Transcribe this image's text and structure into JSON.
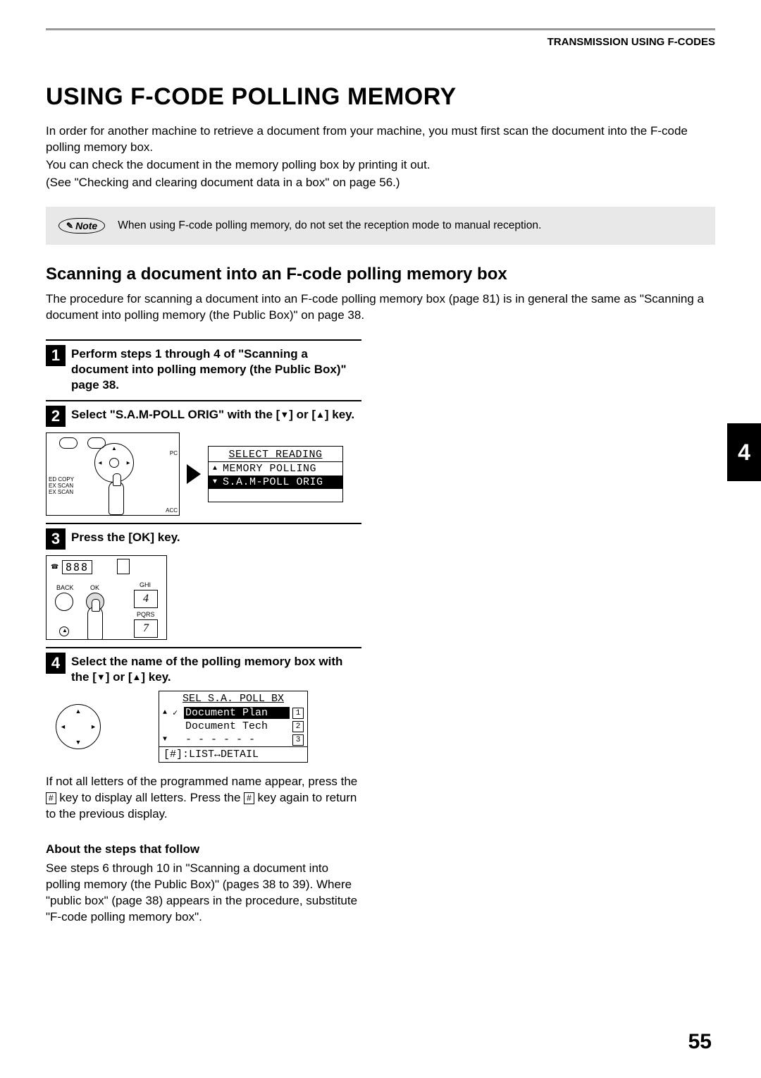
{
  "header": "TRANSMISSION USING F-CODES",
  "h1": "USING F-CODE POLLING MEMORY",
  "intro": [
    "In order for another machine to retrieve a document from your machine, you must first scan the document into the F-code polling memory box.",
    "You can check the document in the memory polling box by printing it out.",
    "(See \"Checking and clearing document data in a box\" on page 56.)"
  ],
  "note_label": "Note",
  "note_text": "When using F-code polling memory, do not set the reception mode to manual reception.",
  "h2": "Scanning a document into an F-code polling memory box",
  "sub_intro": "The procedure for scanning a document into an F-code polling memory box (page 81) is in general the same as \"Scanning a document into polling memory (the Public Box)\" on page 38.",
  "steps": {
    "s1": {
      "num": "1",
      "text": "Perform steps 1 through 4 of \"Scanning a document into polling memory (the Public Box)\" page 38."
    },
    "s2": {
      "num": "2",
      "text_pre": "Select \"S.A.M-POLL ORIG\" with the [",
      "text_post": "] key.",
      "or": "] or ["
    },
    "s3": {
      "num": "3",
      "text": "Press the [OK] key."
    },
    "s4": {
      "num": "4",
      "text_pre": "Select the name of the polling memory box with the [",
      "text_post": "] key.",
      "or": "] or ["
    }
  },
  "panel_labels": {
    "l1": "ED COPY",
    "l2": "EX SCAN",
    "l3": "EX SCAN",
    "acc": "ACC",
    "pc": "PC"
  },
  "lcd1": {
    "title": "SELECT READING",
    "row1": "MEMORY POLLING",
    "row2": "S.A.M-POLL ORIG"
  },
  "keypad": {
    "seg": "888",
    "back": "BACK",
    "ok": "OK",
    "ghi": "GHI",
    "k4": "4",
    "pqrs": "PQRS",
    "k7": "7"
  },
  "lcd2": {
    "title": "SEL S.A. POLL BX",
    "row1": "Document Plan",
    "row2": "Document Tech",
    "row3": "- - - - - -",
    "n1": "1",
    "n2": "2",
    "n3": "3",
    "footer": "[#]:LIST↔DETAIL"
  },
  "followup_p_parts": {
    "a": "If not all letters of the programmed name appear, press the ",
    "b": " key to display all letters. Press the ",
    "c": " key again to return to the previous display."
  },
  "hash_key": "#",
  "about_h": "About the steps that follow",
  "about_p": "See steps 6 through 10 in \"Scanning a document into polling memory (the Public Box)\" (pages 38 to 39). Where \"public box\" (page 38) appears in the procedure, substitute \"F-code polling memory box\".",
  "chapter": "4",
  "page": "55"
}
